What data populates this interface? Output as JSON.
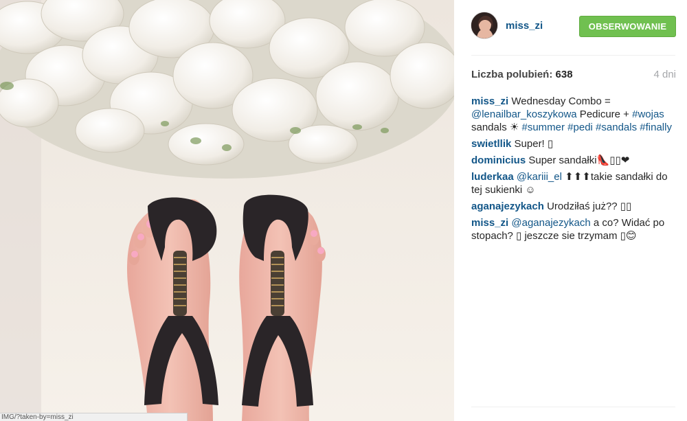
{
  "photo": {
    "status_url": "IMG/?taken-by=miss_zi"
  },
  "header": {
    "username": "miss_zi",
    "follow_label": "OBSERWOWANIE"
  },
  "stats": {
    "likes_label": "Liczba polubień:",
    "likes_count": "638",
    "time_ago": "4 dni"
  },
  "caption": {
    "user": "miss_zi",
    "text_1": "Wednesday Combo =",
    "mention": "@lenailbar_koszykowa",
    "text_2": " Pedicure + ",
    "tag_1": "#wojas",
    "text_3": " sandals ☀ ",
    "tag_2": "#summer",
    "tag_3": "#pedi",
    "tag_4": "#sandals",
    "tag_5": "#finally"
  },
  "comments": [
    {
      "user": "swietllik",
      "text": "Super! ▯"
    },
    {
      "user": "dominicius",
      "text": "Super sandałki👠▯▯❤"
    },
    {
      "user": "luderkaa",
      "mention": "@kariii_el",
      "text": " ⬆⬆⬆takie sandałki do tej sukienki ☺"
    },
    {
      "user": "aganajezykach",
      "text": "Urodziłaś już?? ▯▯"
    },
    {
      "user": "miss_zi",
      "mention": "@aganajezykach",
      "text": " a co? Widać po stopach? ▯ jeszcze sie trzymam ▯😊"
    }
  ],
  "colors": {
    "link": "#125688",
    "follow_button": "#70c050",
    "muted": "#a5a7aa"
  }
}
